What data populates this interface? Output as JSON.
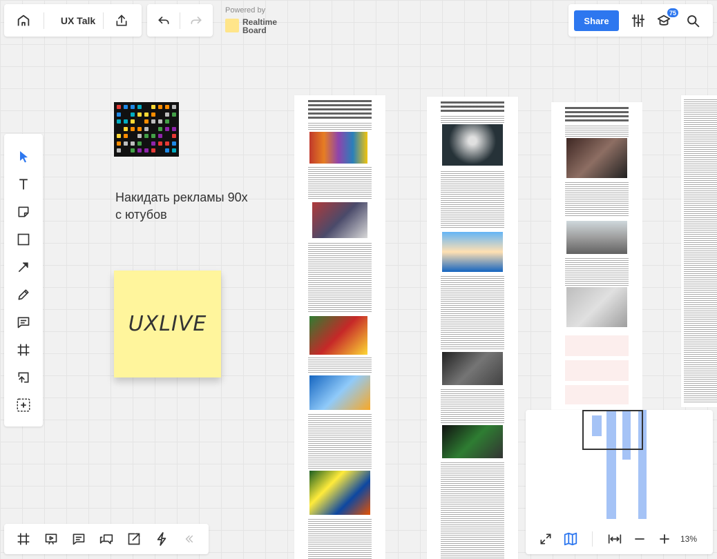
{
  "board": {
    "title": "UX Talk"
  },
  "powered_by": {
    "label": "Powered by",
    "brand_line1": "Realtime",
    "brand_line2": "Board"
  },
  "header": {
    "share_label": "Share",
    "notification_count": "75"
  },
  "canvas": {
    "text_line1": "Накидать рекламы 90х",
    "text_line2": "с ютубов",
    "sticky_note": "UXLIVE"
  },
  "minimap": {
    "zoom": "13%"
  },
  "left_toolbar": {
    "items": [
      "cursor-icon",
      "text-icon",
      "sticky-note-icon",
      "shape-icon",
      "arrow-icon",
      "pen-icon",
      "comment-icon",
      "frame-icon",
      "upload-icon",
      "more-tools-icon"
    ]
  },
  "bottom_toolbar": {
    "items": [
      "frames-icon",
      "presentation-icon",
      "chat-icon",
      "comments-icon",
      "screen-share-icon",
      "activity-icon",
      "collapse-icon"
    ]
  },
  "colors": {
    "accent": "#2d77ef",
    "sticky": "#fff59c",
    "minimap_bar": "#a5c3f6"
  }
}
